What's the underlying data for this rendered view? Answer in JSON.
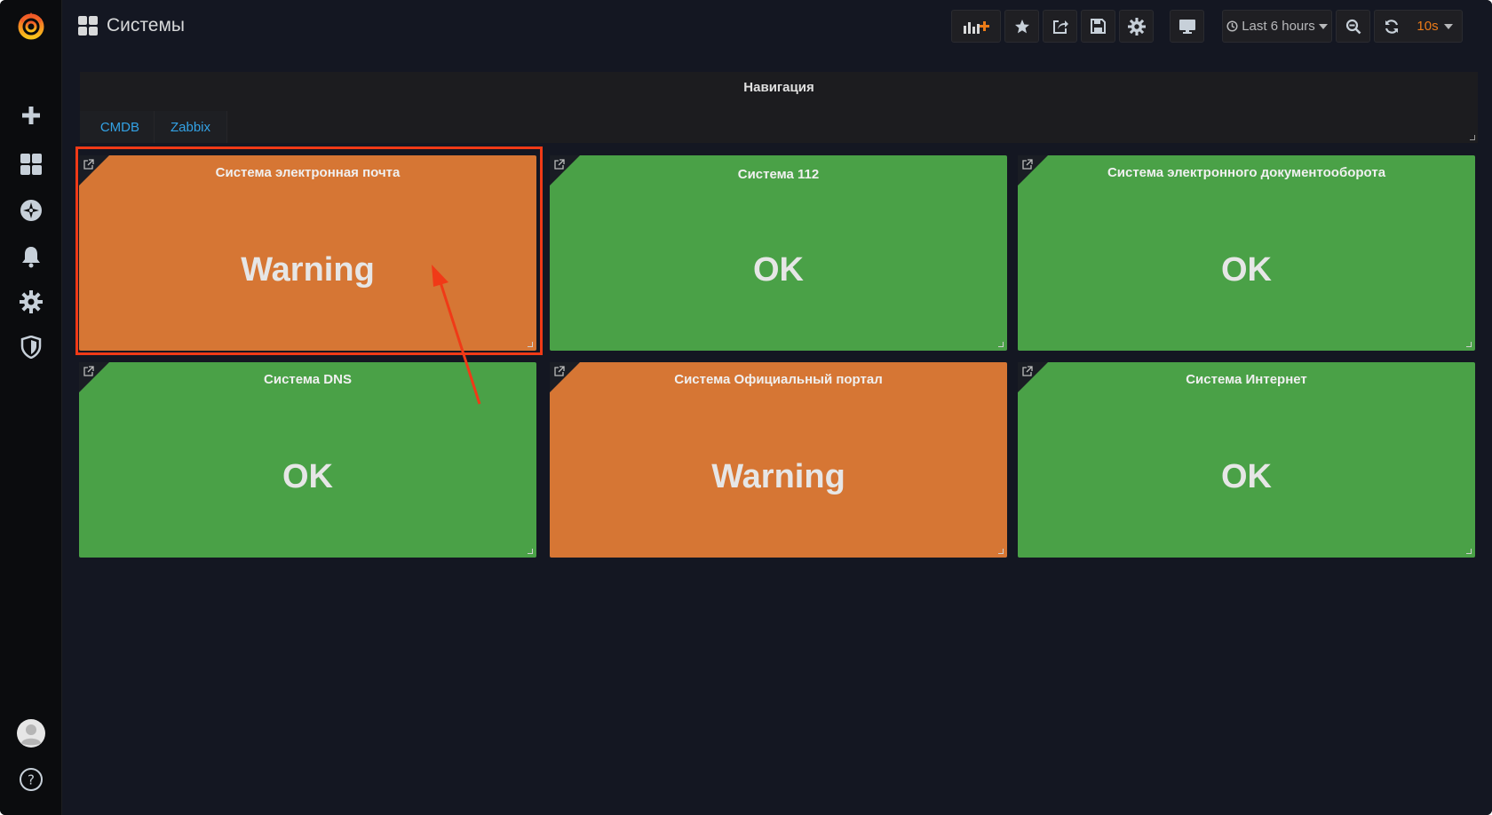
{
  "dashboard": {
    "title": "Системы",
    "icon": "dashboard-grid-icon"
  },
  "sidebar": {
    "logo": "grafana-logo-icon",
    "items": [
      {
        "name": "create",
        "icon": "plus-icon"
      },
      {
        "name": "dashboards",
        "icon": "dashboard-grid-icon"
      },
      {
        "name": "explore",
        "icon": "compass-icon"
      },
      {
        "name": "alerting",
        "icon": "bell-icon"
      },
      {
        "name": "configuration",
        "icon": "gear-icon"
      },
      {
        "name": "server-admin",
        "icon": "shield-icon"
      }
    ],
    "bottom": [
      {
        "name": "profile",
        "icon": "avatar-icon"
      },
      {
        "name": "help",
        "icon": "help-icon"
      }
    ]
  },
  "toolbar": {
    "add_panel_icon": "add-panel-icon",
    "star_icon": "star-icon",
    "share_icon": "share-icon",
    "save_icon": "save-icon",
    "settings_icon": "gear-icon",
    "tv_mode_icon": "monitor-icon",
    "time_range": "Last 6 hours",
    "zoom_out_icon": "zoom-out-icon",
    "refresh_icon": "refresh-icon",
    "refresh_interval": "10s"
  },
  "navigation": {
    "title": "Навигация",
    "links": [
      "CMDB",
      "Zabbix"
    ]
  },
  "panels": [
    {
      "title": "Система электронная почта",
      "value": "Warning",
      "status": "warning"
    },
    {
      "title": "Система 112",
      "value": "OK",
      "status": "ok"
    },
    {
      "title": "Система электронного документооборота",
      "value": "OK",
      "status": "ok"
    },
    {
      "title": "Система DNS",
      "value": "OK",
      "status": "ok"
    },
    {
      "title": "Система Официальный портал",
      "value": "Warning",
      "status": "warning"
    },
    {
      "title": "Система Интернет",
      "value": "OK",
      "status": "ok"
    }
  ],
  "colors": {
    "warning": "#d67634",
    "ok": "#4aa147",
    "annotation": "#f03a17",
    "link": "#33a2e5",
    "refresh_accent": "#eb7b18"
  },
  "annotation": {
    "highlighted_panel": "Система электронная почта"
  }
}
